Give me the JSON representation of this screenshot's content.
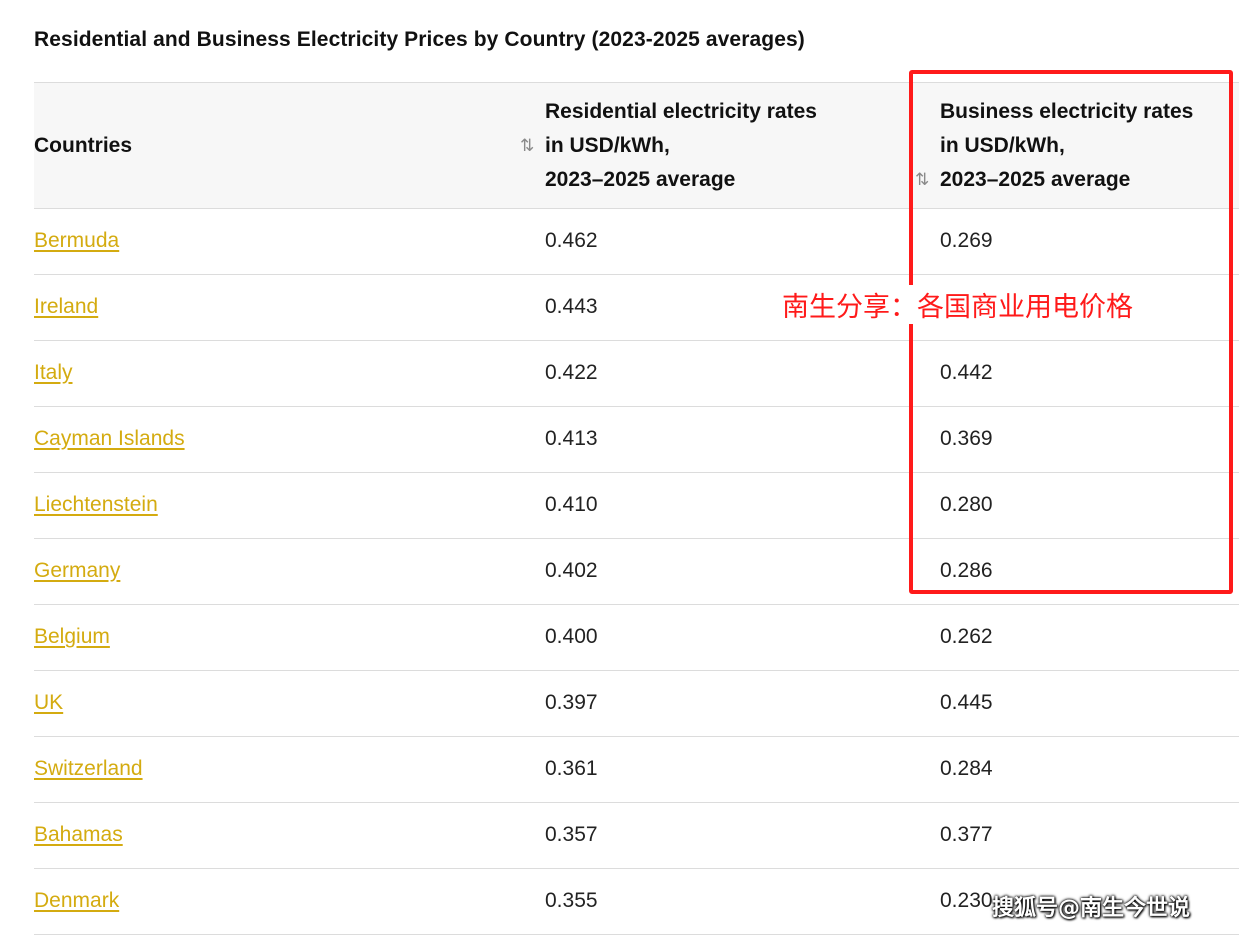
{
  "title": "Residential and Business Electricity Prices by Country (2023-2025 averages)",
  "table": {
    "headers": {
      "country": "Countries",
      "residential": [
        "Residential electricity rates",
        "in USD/kWh,",
        "2023–2025 average"
      ],
      "business": [
        "Business electricity rates",
        "in USD/kWh,",
        "2023–2025 average"
      ],
      "sort_icon": "⇅"
    },
    "rows": [
      {
        "country": "Bermuda",
        "residential": "0.462",
        "business": "0.269"
      },
      {
        "country": "Ireland",
        "residential": "0.443",
        "business": ""
      },
      {
        "country": "Italy",
        "residential": "0.422",
        "business": "0.442"
      },
      {
        "country": "Cayman Islands",
        "residential": "0.413",
        "business": "0.369"
      },
      {
        "country": "Liechtenstein",
        "residential": "0.410",
        "business": "0.280"
      },
      {
        "country": "Germany",
        "residential": "0.402",
        "business": "0.286"
      },
      {
        "country": "Belgium",
        "residential": "0.400",
        "business": "0.262"
      },
      {
        "country": "UK",
        "residential": "0.397",
        "business": "0.445"
      },
      {
        "country": "Switzerland",
        "residential": "0.361",
        "business": "0.284"
      },
      {
        "country": "Bahamas",
        "residential": "0.357",
        "business": "0.377"
      },
      {
        "country": "Denmark",
        "residential": "0.355",
        "business": "0.230"
      }
    ]
  },
  "annotation": "南生分享：各国商业用电价格",
  "watermark": "搜狐号@南生今世说",
  "colors": {
    "link": "#d4ab10",
    "highlight": "#ff1a1a",
    "header_bg": "#f7f7f7"
  }
}
